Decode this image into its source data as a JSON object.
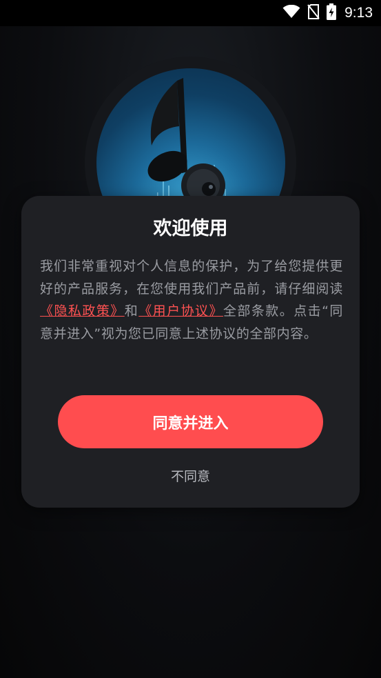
{
  "status_bar": {
    "time": "9:13",
    "icons": [
      "wifi-icon",
      "no-sim-icon",
      "battery-charging-icon"
    ]
  },
  "dialog": {
    "title": "欢迎使用",
    "body_prefix": "我们非常重视对个人信息的保护，为了给您提供更好的产品服务，在您使用我们产品前，请仔细阅读",
    "privacy_link": "《隐私政策》",
    "connector": "和",
    "user_agreement_link": "《用户协议》",
    "body_suffix": "全部条款。点击“同意并进入”视为您已同意上述协议的全部内容。",
    "agree_label": "同意并进入",
    "disagree_label": "不同意"
  },
  "colors": {
    "accent": "#ff4d4f",
    "link": "#ff5252",
    "dialog_bg": "#1f2024",
    "body_text": "#9a9ca2"
  }
}
